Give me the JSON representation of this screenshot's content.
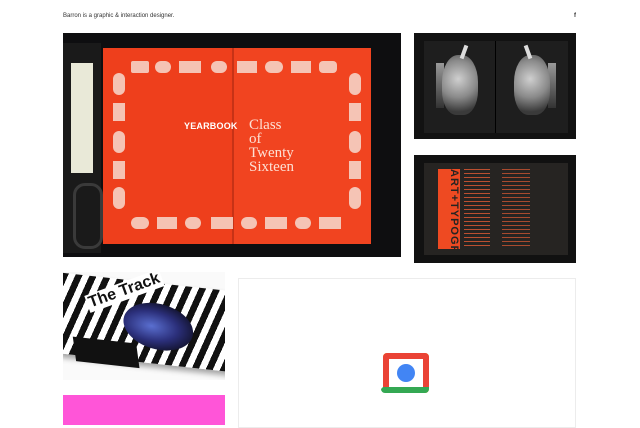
{
  "header": {
    "tagline": "Barron is a graphic & interaction designer.",
    "social_label": "f"
  },
  "tiles": {
    "yearbook": {
      "cover_label": "YEARBOOK",
      "title_lines": [
        "Class",
        "of",
        "Twenty",
        "Sixteen"
      ]
    },
    "art_spread": {
      "spine_text": "ART+TYPOGRAPHY"
    },
    "book": {
      "title": "The Track"
    }
  },
  "colors": {
    "yearbook_orange": "#ee3f1c",
    "pink": "#ff55d8",
    "accent_red": "#e75a33"
  },
  "icons": {
    "placeholder": "google-slides-like-icon"
  }
}
